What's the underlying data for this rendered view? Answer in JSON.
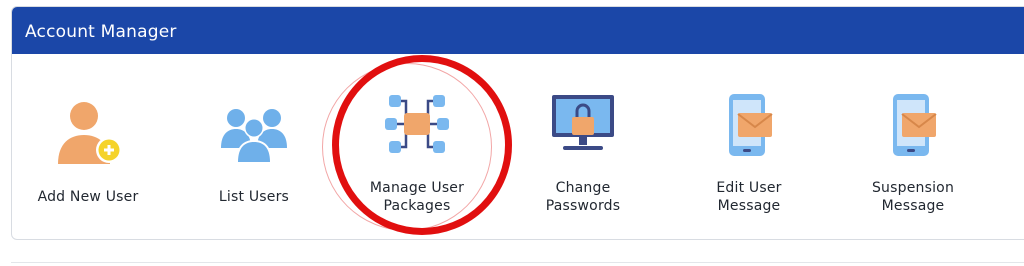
{
  "panel": {
    "title": "Account Manager",
    "header_color": "#1b47a8",
    "highlight_color": "#e10f0f"
  },
  "tiles": [
    {
      "icon": "add-user-icon",
      "label_lines": [
        "Add New User"
      ]
    },
    {
      "icon": "users-group-icon",
      "label_lines": [
        "List Users"
      ]
    },
    {
      "icon": "package-network-icon",
      "label_lines": [
        "Manage User",
        "Packages"
      ]
    },
    {
      "icon": "monitor-lock-icon",
      "label_lines": [
        "Change",
        "Passwords"
      ]
    },
    {
      "icon": "phone-message-icon",
      "label_lines": [
        "Edit User",
        "Message"
      ]
    },
    {
      "icon": "phone-message-icon",
      "label_lines": [
        "Suspension",
        "Message"
      ]
    }
  ]
}
